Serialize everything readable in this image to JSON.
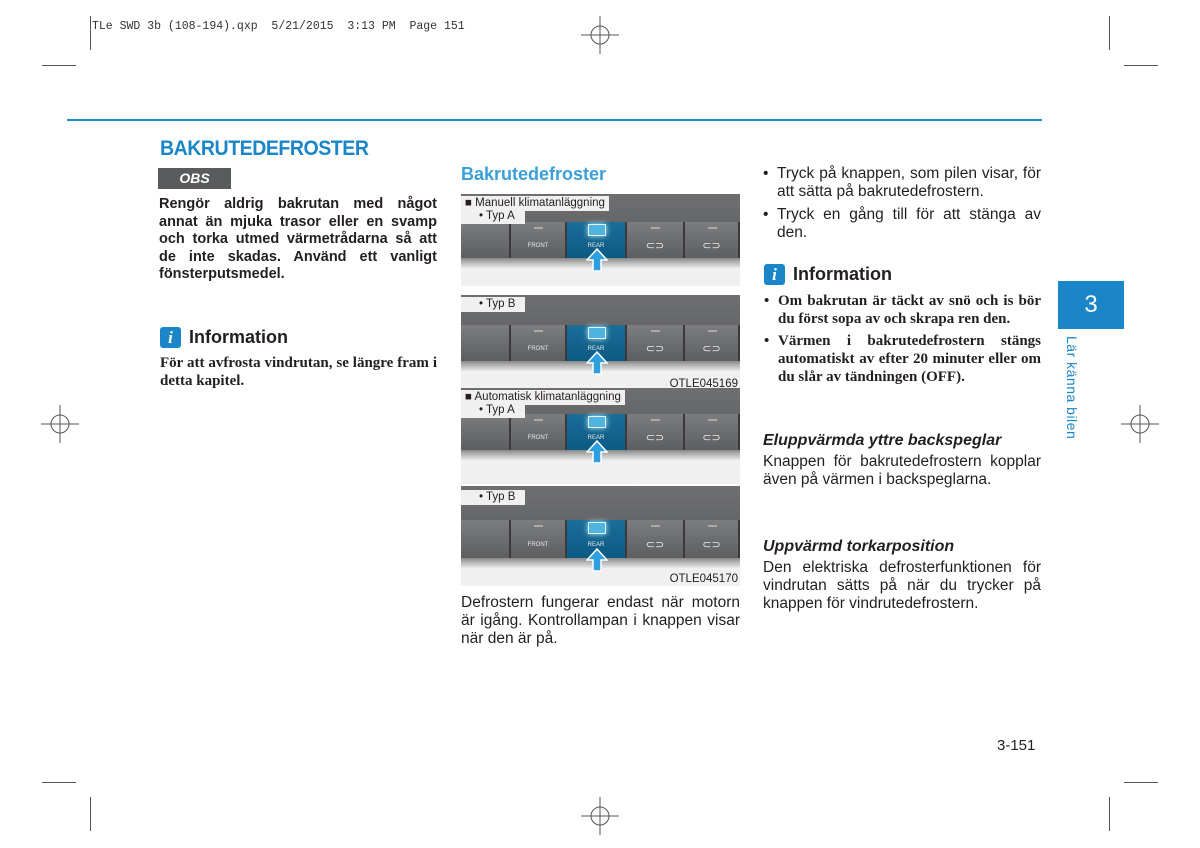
{
  "print_slug": "TLe SWD 3b (108-194).qxp  5/21/2015  3:13 PM  Page 151",
  "section_title": "BAKRUTEDEFROSTER",
  "obs": {
    "label": "OBS",
    "text": "Rengör aldrig bakrutan med något annat än mjuka trasor eller en svamp och torka utmed värmetrådarna så att de inte skadas. Använd ett vanligt fönsterputsmedel."
  },
  "info_left": {
    "icon": "info-icon",
    "icon_glyph": "i",
    "title": "Information",
    "text": "För att avfrosta vindrutan, se längre fram i detta kapitel."
  },
  "middle": {
    "subtitle": "Bakrutedefroster",
    "figures": [
      {
        "group_label": "■ Manuell klimatanläggning",
        "type_label": "• Typ A",
        "buttons": [
          "",
          "FRONT",
          "REAR",
          "",
          ""
        ],
        "active_button": "REAR",
        "code": ""
      },
      {
        "group_label": "",
        "type_label": "• Typ B",
        "buttons": [
          "",
          "FRONT",
          "REAR",
          "",
          ""
        ],
        "active_button": "REAR",
        "code": "OTLE045169"
      },
      {
        "group_label": "■ Automatisk klimatanläggning",
        "type_label": "• Typ A",
        "buttons": [
          "",
          "FRONT",
          "REAR",
          "",
          ""
        ],
        "active_button": "REAR",
        "code": ""
      },
      {
        "group_label": "",
        "type_label": "• Typ B",
        "buttons": [
          "",
          "FRONT",
          "REAR",
          "",
          ""
        ],
        "active_button": "REAR",
        "code": "OTLE045170"
      }
    ],
    "text": "Defrostern fungerar endast när motorn är igång. Kontrollampan i knappen visar när den är på."
  },
  "right": {
    "bullets": [
      "Tryck på knappen, som pilen visar, för att sätta på bakrutedefrostern.",
      "Tryck en gång till för att stänga av den."
    ],
    "info": {
      "icon": "info-icon",
      "icon_glyph": "i",
      "title": "Information",
      "bullets": [
        "Om bakrutan är täckt av snö och is bör du först sopa av och skrapa ren den.",
        "Värmen i bakrutedefrostern stängs automatiskt av efter 20 minuter eller om du slår av tändningen (OFF)."
      ]
    },
    "mirrors": {
      "title": "Eluppvärmda yttre backspeglar",
      "text": "Knappen för bakrutedefrostern kopplar även på värmen i backspeglarna."
    },
    "wiper": {
      "title": "Uppvärmd torkarposition",
      "text": "Den elektriska defrosterfunktionen för vindrutan sätts på när du trycker på knappen för vindrutedefrostern."
    }
  },
  "chapter": {
    "number": "3",
    "label": "Lär känna bilen"
  },
  "page_number": "3-151",
  "colors": {
    "accent": "#1a86c8",
    "obs_bg": "#5a5b5d",
    "active_button": "#0c5a84",
    "arrow": "#2e9fe0"
  }
}
